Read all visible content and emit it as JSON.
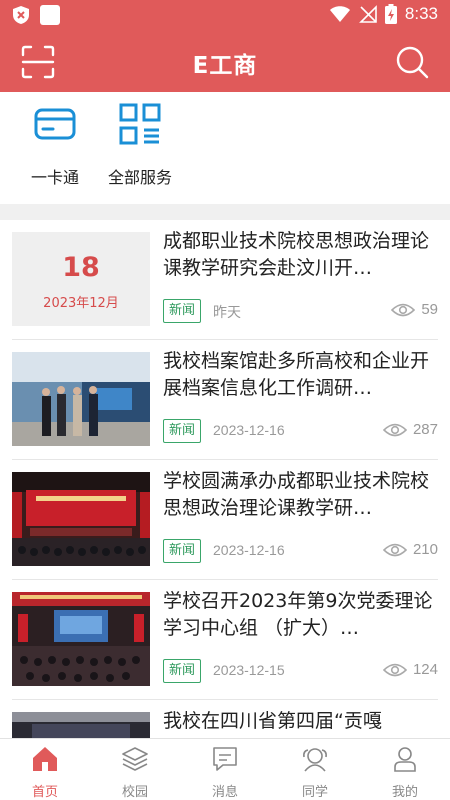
{
  "status_bar": {
    "time": "8:33"
  },
  "header": {
    "title": "E工商",
    "scan_icon": "scan-icon",
    "search_icon": "search-icon"
  },
  "quick_services": [
    {
      "label": "一卡通",
      "icon": "card-icon"
    },
    {
      "label": "全部服务",
      "icon": "grid-menu-icon"
    }
  ],
  "news": [
    {
      "title": "成都职业技术院校思想政治理论课教学研究会赴汶川开…",
      "tag": "新闻",
      "date": "昨天",
      "views": "59",
      "thumb_day": "18",
      "thumb_month": "2023年12月"
    },
    {
      "title": "我校档案馆赴多所高校和企业开展档案信息化工作调研…",
      "tag": "新闻",
      "date": "2023-12-16",
      "views": "287"
    },
    {
      "title": "学校圆满承办成都职业技术院校思想政治理论课教学研…",
      "tag": "新闻",
      "date": "2023-12-16",
      "views": "210"
    },
    {
      "title": "学校召开2023年第9次党委理论学习中心组 （扩大）…",
      "tag": "新闻",
      "date": "2023-12-15",
      "views": "124"
    },
    {
      "title": "我校在四川省第四届“贡嘎"
    }
  ],
  "tabs": [
    {
      "label": "首页",
      "icon": "home-icon",
      "active": true
    },
    {
      "label": "校园",
      "icon": "layers-icon"
    },
    {
      "label": "消息",
      "icon": "message-icon"
    },
    {
      "label": "同学",
      "icon": "classmates-icon"
    },
    {
      "label": "我的",
      "icon": "profile-icon"
    }
  ],
  "colors": {
    "brand": "#e05a5a",
    "accent_blue": "#1a8fd6",
    "tag_green": "#2f9a5d"
  }
}
